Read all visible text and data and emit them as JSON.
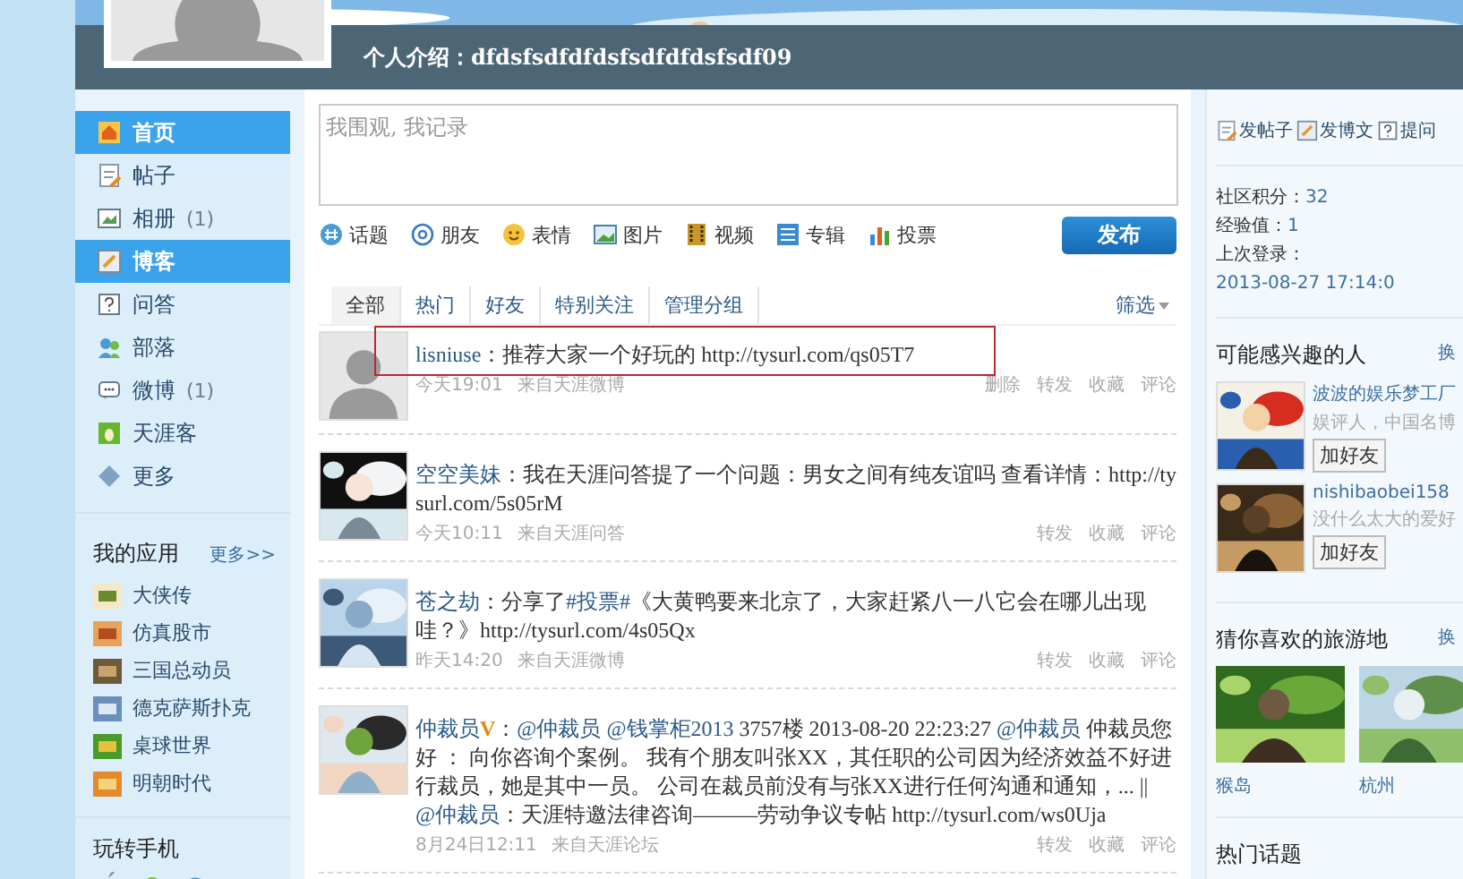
{
  "header": {
    "intro": "个人介绍：dfdsfsdfdfdsfsdfdfdsfsdf09"
  },
  "nav": {
    "items": [
      {
        "label": "首页",
        "selected": true
      },
      {
        "label": "帖子",
        "selected": false
      },
      {
        "label": "相册",
        "count": "(1)",
        "selected": false
      },
      {
        "label": "博客",
        "selected": true
      },
      {
        "label": "问答",
        "selected": false
      },
      {
        "label": "部落",
        "selected": false
      },
      {
        "label": "微博",
        "count": "(1)",
        "selected": false
      },
      {
        "label": "天涯客",
        "selected": false
      },
      {
        "label": "更多",
        "selected": false
      }
    ]
  },
  "apps": {
    "title": "我的应用",
    "more": "更多>>",
    "items": [
      "大侠传",
      "仿真股市",
      "三国总动员",
      "德克萨斯扑克",
      "桌球世界",
      "明朝时代"
    ]
  },
  "mobile": {
    "title": "玩转手机"
  },
  "composer": {
    "placeholder": "我围观, 我记录",
    "tools": [
      "话题",
      "朋友",
      "表情",
      "图片",
      "视频",
      "专辑",
      "投票"
    ],
    "submit": "发布"
  },
  "feed": {
    "tabs": [
      {
        "label": "全部",
        "selected": true
      },
      {
        "label": "热门",
        "selected": false
      },
      {
        "label": "好友",
        "selected": false
      },
      {
        "label": "特别关注",
        "selected": false
      },
      {
        "label": "管理分组",
        "selected": false
      }
    ],
    "filter": "筛选",
    "posts": [
      {
        "avatar_photo": false,
        "highlighted": true,
        "author": "lisniuse",
        "segments": [
          {
            "kind": "text",
            "text": "：推荐大家一个好玩的 http://tysurl.com/qs05T7"
          }
        ],
        "time": "今天19:01",
        "source": "来自天涯微博",
        "actions": [
          "删除",
          "转发",
          "收藏",
          "评论"
        ]
      },
      {
        "avatar_photo": true,
        "highlighted": false,
        "author": "空空美妹",
        "segments": [
          {
            "kind": "text",
            "text": "：我在天涯问答提了一个问题：男女之间有纯友谊吗 查看详情：http://tysurl.com/5s05rM"
          }
        ],
        "time": "今天10:11",
        "source": "来自天涯问答",
        "actions": [
          "转发",
          "收藏",
          "评论"
        ]
      },
      {
        "avatar_photo": true,
        "highlighted": false,
        "author": "苍之劫",
        "segments": [
          {
            "kind": "text",
            "text": "：分享了"
          },
          {
            "kind": "link",
            "text": "#投票#"
          },
          {
            "kind": "text",
            "text": "《大黄鸭要来北京了，大家赶紧八一八它会在哪儿出现哇？》http://tysurl.com/4s05Qx"
          }
        ],
        "time": "昨天14:20",
        "source": "来自天涯微博",
        "actions": [
          "转发",
          "收藏",
          "评论"
        ]
      },
      {
        "avatar_photo": true,
        "highlighted": false,
        "author": "仲裁员",
        "badge": "V",
        "segments": [
          {
            "kind": "text",
            "text": "："
          },
          {
            "kind": "link",
            "text": "@仲裁员"
          },
          {
            "kind": "link",
            "text": "@钱掌柜2013"
          },
          {
            "kind": "text",
            "text": " 3757楼 2013-08-20 22:23:27 "
          },
          {
            "kind": "link",
            "text": "@仲裁员"
          },
          {
            "kind": "text",
            "text": " 仲裁员您好 ： 向你咨询个案例。 我有个朋友叫张XX，其任职的公司因为经济效益不好进行裁员，她是其中一员。 公司在裁员前没有与张XX进行任何沟通和通知，... || "
          },
          {
            "kind": "link",
            "text": "@仲裁员"
          },
          {
            "kind": "text",
            "text": "：天涯特邀法律咨询———劳动争议专帖 http://tysurl.com/ws0Uja"
          }
        ],
        "time": "8月24日12:11",
        "source": "来自天涯论坛",
        "actions": [
          "转发",
          "收藏",
          "评论"
        ]
      }
    ]
  },
  "right": {
    "actions": [
      "发帖子",
      "发博文",
      "提问"
    ],
    "stats": [
      {
        "label": "社区积分：",
        "value": "32"
      },
      {
        "label": "经验值：",
        "value": "1"
      },
      {
        "label": "上次登录：",
        "value": "2013-08-27 17:14:0"
      }
    ],
    "people": {
      "title": "可能感兴趣的人",
      "more": "换",
      "items": [
        {
          "name": "波波的娱乐梦工厂",
          "bio": "娱评人，中国名博",
          "button": "加好友"
        },
        {
          "name": "nishibaobei158",
          "bio": "没什么太大的爱好",
          "button": "加好友"
        }
      ]
    },
    "travel": {
      "title": "猜你喜欢的旅游地",
      "more": "换",
      "places": [
        "猴岛",
        "杭州"
      ]
    },
    "hot": {
      "title": "热门话题"
    }
  }
}
